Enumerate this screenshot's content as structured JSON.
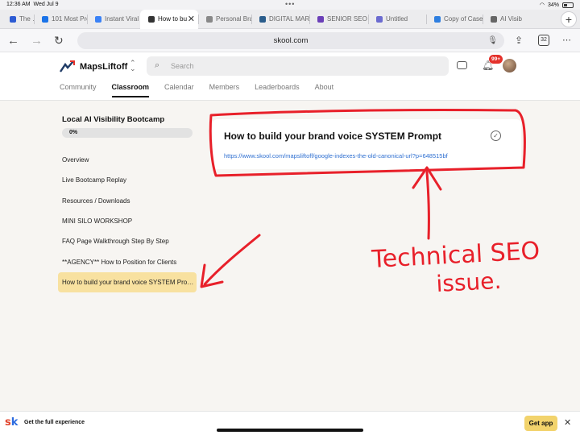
{
  "status_bar": {
    "time": "12:36 AM",
    "date": "Wed Jul 9",
    "battery": "34%"
  },
  "tabs": [
    {
      "label": "The …",
      "fav_color": "#2d5bd3"
    },
    {
      "label": "101 Most Pro",
      "fav_color": "#1a73e8"
    },
    {
      "label": "Instant Viral",
      "fav_color": "#3b82f6"
    },
    {
      "label": "How to bu",
      "fav_color": "#333333",
      "active": true
    },
    {
      "label": "Personal Bra",
      "fav_color": "#888888"
    },
    {
      "label": "DIGITAL MAR",
      "fav_color": "#2b5d8c"
    },
    {
      "label": "SENIOR SEO",
      "fav_color": "#6b3fb8"
    },
    {
      "label": "Untitled",
      "fav_color": "#6b6bd0"
    },
    {
      "label": "Copy of Case",
      "fav_color": "#2f7fe0"
    },
    {
      "label": "AI Visib",
      "fav_color": "#666666"
    }
  ],
  "toolbar": {
    "url": "skool.com",
    "tab_count": "32"
  },
  "header": {
    "brand": "MapsLiftoff",
    "search_placeholder": "Search",
    "notification_count": "99+",
    "nav": [
      "Community",
      "Classroom",
      "Calendar",
      "Members",
      "Leaderboards",
      "About"
    ],
    "active_nav": "Classroom"
  },
  "course": {
    "title": "Local AI Visibility Bootcamp",
    "progress_percent": 0,
    "progress_label": "0%",
    "lessons": [
      "Overview",
      "Live Bootcamp Replay",
      "Resources / Downloads",
      "MINI SILO WORKSHOP",
      "FAQ Page Walkthrough Step By Step",
      "**AGENCY** How to Position for Clients",
      "How to build your brand voice SYSTEM Prompt"
    ],
    "active_lesson": 6
  },
  "lesson_card": {
    "title": "How to build your brand voice SYSTEM Prompt",
    "link": "https://www.skool.com/mapsliftoff/google-indexes-the-old-canonical-url?p=648515bf"
  },
  "annotation": {
    "line1": "Technical SEO",
    "line2": "issue.",
    "color": "#e8202a"
  },
  "banner": {
    "text": "Get the full experience",
    "button": "Get app"
  }
}
